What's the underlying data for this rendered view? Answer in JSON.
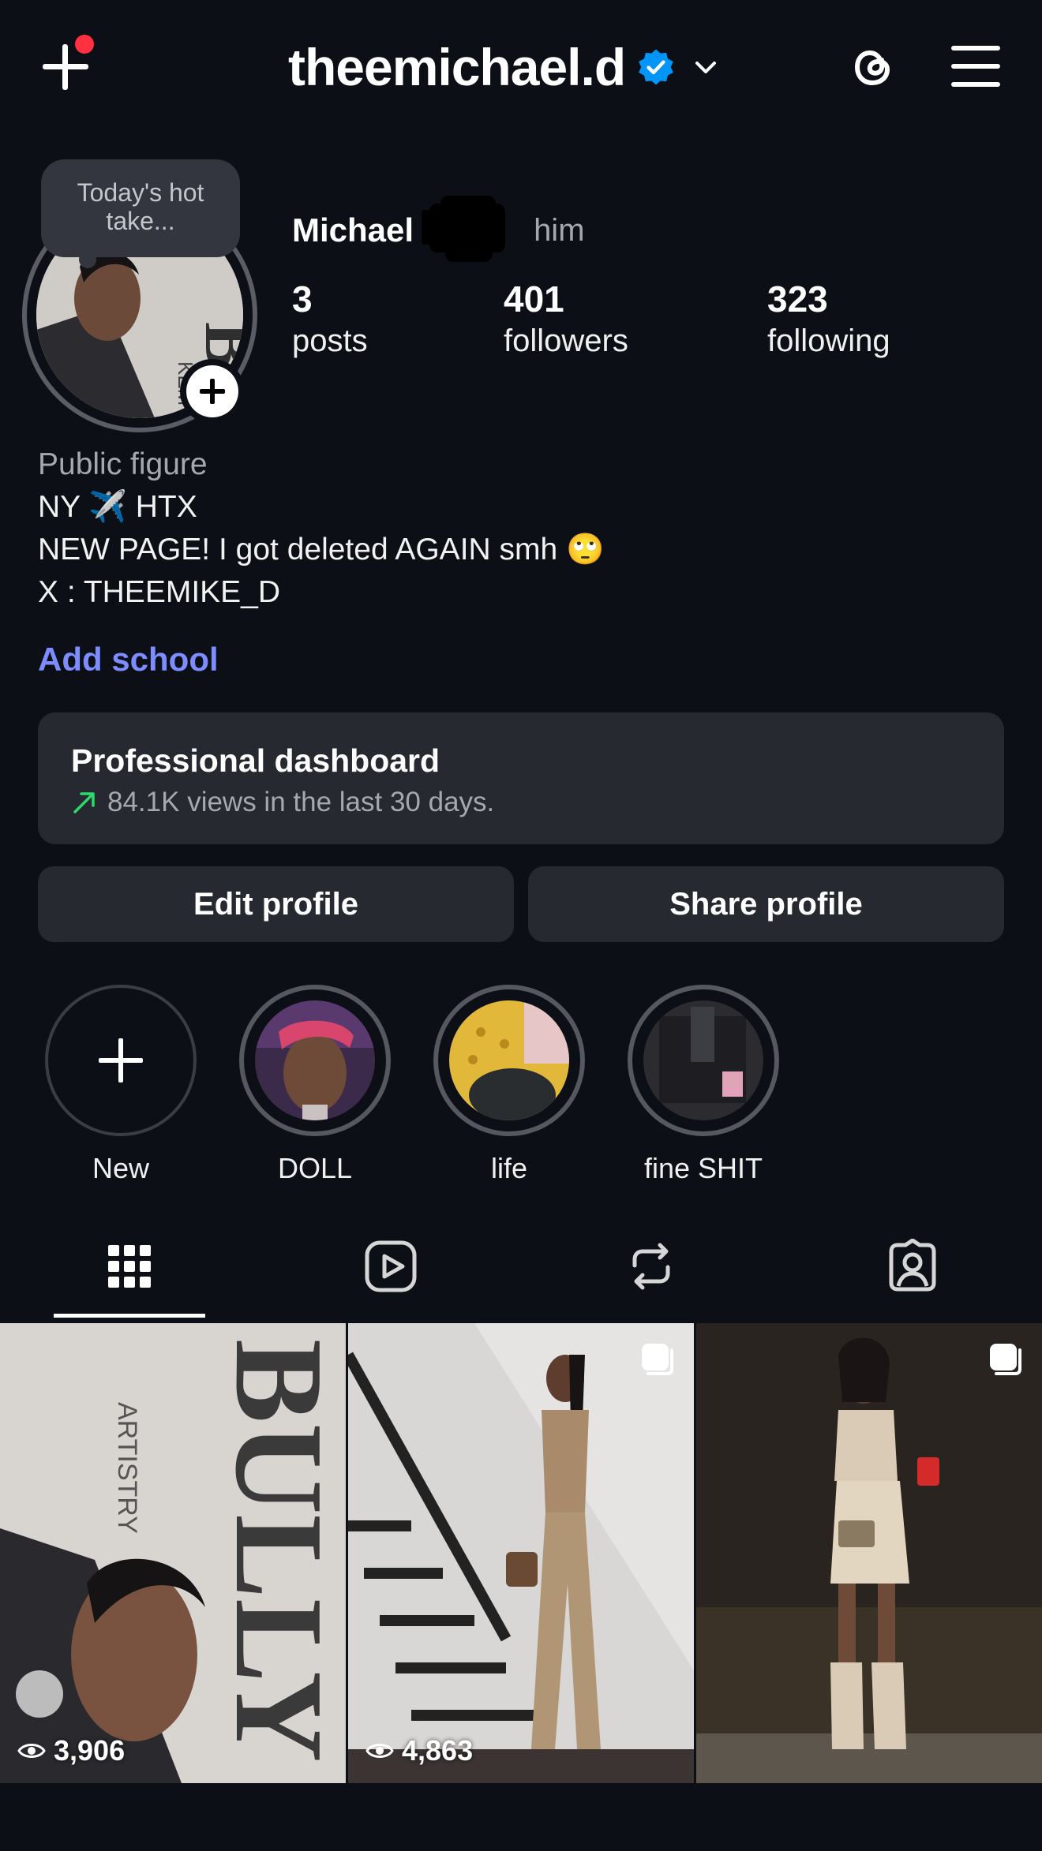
{
  "header": {
    "username": "theemichael.d",
    "icons": {
      "create": "plus-icon",
      "notification_dot_color": "#ff3040",
      "verified": "verified-badge-icon",
      "account_switch": "chevron-down-icon",
      "threads": "threads-icon",
      "menu": "hamburger-menu-icon"
    },
    "verified_color": "#0095f6"
  },
  "note": {
    "text": "Today's hot take..."
  },
  "profile": {
    "full_name": "Michael",
    "pronouns": "him",
    "stats": [
      {
        "value": "3",
        "label": "posts"
      },
      {
        "value": "401",
        "label": "followers"
      },
      {
        "value": "323",
        "label": "following"
      }
    ]
  },
  "bio": {
    "category": "Public figure",
    "lines": [
      "NY ✈️ HTX",
      "NEW PAGE! I got deleted AGAIN smh 🙄",
      "X : THEEMIKE_D"
    ],
    "add_school": "Add school"
  },
  "dashboard": {
    "title": "Professional dashboard",
    "subtitle": "84.1K views in the last 30 days.",
    "trend_color": "#2bd96b"
  },
  "actions": {
    "edit": "Edit profile",
    "share": "Share profile"
  },
  "highlights": [
    {
      "label": "New"
    },
    {
      "label": "DOLL"
    },
    {
      "label": "life"
    },
    {
      "label": "fine SHIT"
    }
  ],
  "tabs": [
    {
      "icon": "grid-icon",
      "active": true
    },
    {
      "icon": "reels-icon",
      "active": false
    },
    {
      "icon": "reposts-icon",
      "active": false
    },
    {
      "icon": "tagged-icon",
      "active": false
    }
  ],
  "posts": [
    {
      "views": "3,906",
      "multi": false
    },
    {
      "views": "4,863",
      "multi": true
    },
    {
      "views": "",
      "multi": true
    }
  ],
  "colors": {
    "background": "#0c0f16",
    "card": "#262930",
    "link": "#7d8cff",
    "secondary_text": "#a6a8ae"
  }
}
